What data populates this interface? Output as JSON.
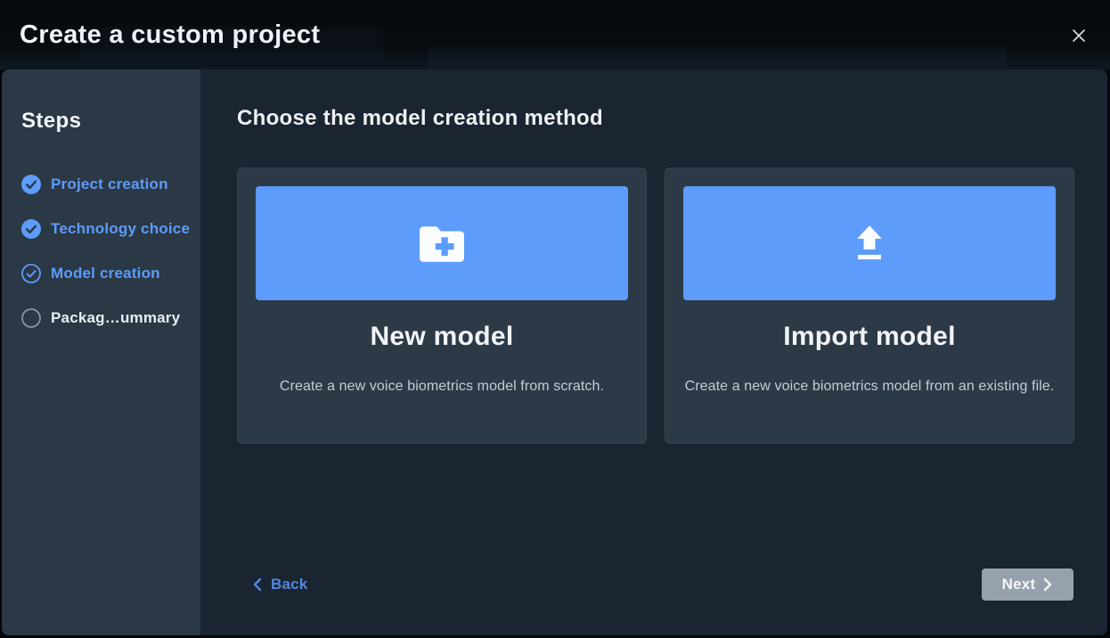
{
  "window": {
    "title": "Create a custom project"
  },
  "header": {
    "close_icon": "close-icon"
  },
  "sidebar": {
    "title": "Steps",
    "steps": [
      {
        "label": "Project creation",
        "state": "completed",
        "icon": "check-circle-filled-icon"
      },
      {
        "label": "Technology choice",
        "state": "completed",
        "icon": "check-circle-filled-icon"
      },
      {
        "label": "Model creation",
        "state": "active",
        "icon": "check-circle-outline-icon"
      },
      {
        "label": "Packag…ummary",
        "state": "pending",
        "icon": "circle-outline-icon"
      }
    ]
  },
  "main": {
    "heading": "Choose the model creation method",
    "cards": [
      {
        "icon": "folder-plus-icon",
        "title": "New model",
        "description": "Create a new voice biometrics model from scratch."
      },
      {
        "icon": "upload-icon",
        "title": "Import model",
        "description": "Create a new voice biometrics model from an existing file."
      }
    ]
  },
  "footer": {
    "back_label": "Back",
    "next_label": "Next",
    "next_enabled": false
  },
  "colors": {
    "accent": "#5d9cfa",
    "link": "#4e88de",
    "sidebar_bg": "#2b3846",
    "main_bg": "#1b2531",
    "card_bg": "#2c3a48",
    "header_bg": "#070a0e",
    "disabled_button": "#97a1ab"
  }
}
